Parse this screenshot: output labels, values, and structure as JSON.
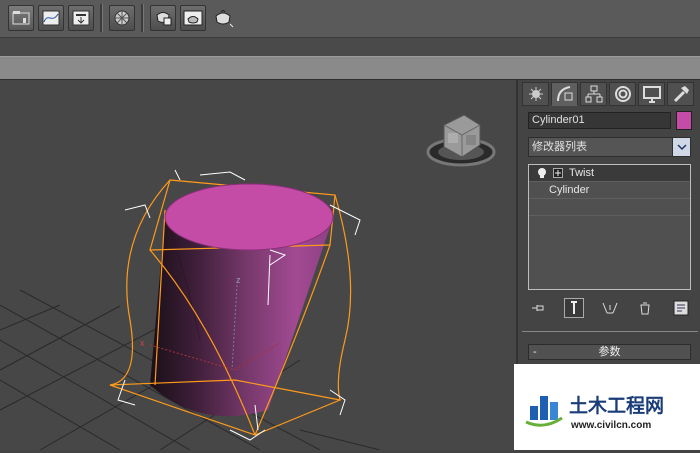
{
  "toolbar": {
    "buttons": [
      "scene-explorer-icon",
      "curve-editor-icon",
      "schematic-view-icon",
      "material-editor-icon",
      "render-setup-icon",
      "rendered-frame-icon",
      "render-icon"
    ]
  },
  "viewport": {
    "object_color": "#c44ba6",
    "axis_labels": {
      "x": "x",
      "z": "z"
    }
  },
  "command_panel": {
    "tabs": [
      "create-tab",
      "modify-tab",
      "hierarchy-tab",
      "motion-tab",
      "display-tab",
      "utilities-tab"
    ],
    "object_name": "Cylinder01",
    "object_color": "#c44ba6",
    "modifier_list_label": "修改器列表",
    "stack": [
      {
        "label": "Twist",
        "selected": true
      },
      {
        "label": "Cylinder",
        "selected": false
      }
    ],
    "rollout_title": "参数",
    "rollout_toggle": "-"
  },
  "watermark": {
    "title": "土木工程网",
    "url": "www.civilcn.com"
  }
}
